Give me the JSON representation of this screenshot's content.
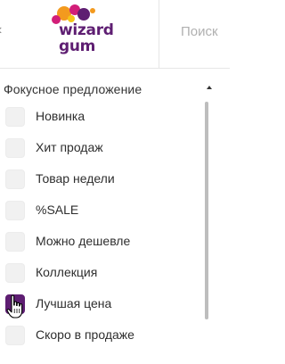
{
  "header": {
    "logo_line1": "wizard",
    "logo_line2": "gum",
    "search_placeholder": "Поиск"
  },
  "filter": {
    "title": "Фокусное предложение",
    "options": [
      {
        "label": "Новинка",
        "checked": false
      },
      {
        "label": "Хит продаж",
        "checked": false
      },
      {
        "label": "Товар недели",
        "checked": false
      },
      {
        "label": "%SALE",
        "checked": false
      },
      {
        "label": "Можно дешевле",
        "checked": false
      },
      {
        "label": "Коллекция",
        "checked": false
      },
      {
        "label": "Лучшая цена",
        "checked": true
      },
      {
        "label": "Скоро в продаже",
        "checked": false
      }
    ]
  },
  "colors": {
    "brand": "#5e1e72",
    "accent_orange": "#f39a1e",
    "accent_pink": "#d21e78",
    "accent_yellow": "#f5c518"
  },
  "icons": {
    "back": "chevron-left-icon",
    "collapse": "caret-up-icon",
    "cursor": "hand-pointer-icon"
  }
}
